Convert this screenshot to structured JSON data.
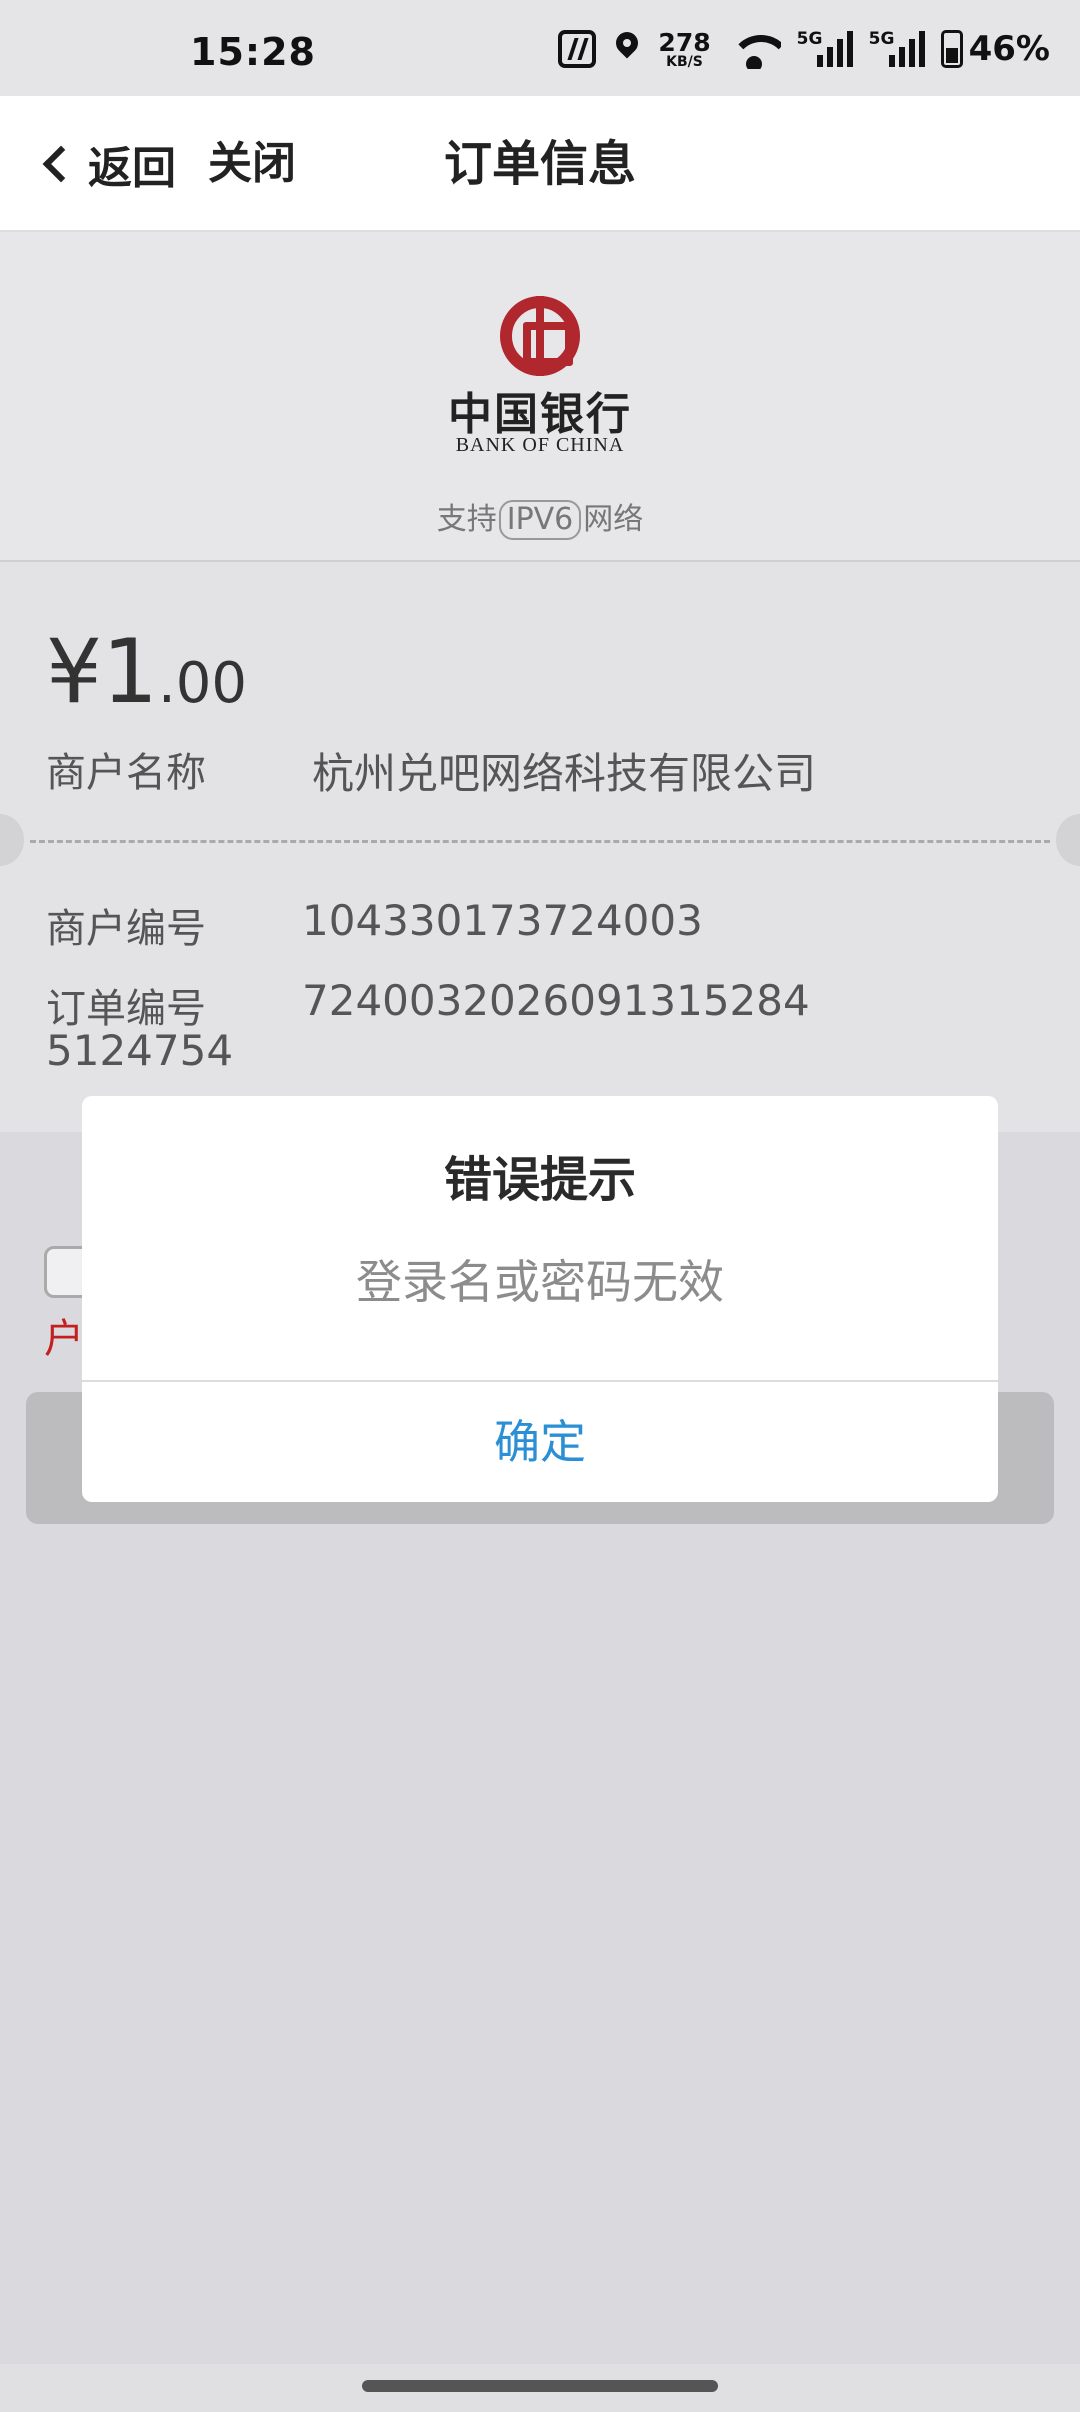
{
  "status_bar": {
    "time": "15:28",
    "speed_value": "278",
    "speed_unit": "KB/S",
    "signal_1": "5G",
    "signal_2": "5G",
    "battery": "46%",
    "icons": [
      "nfc-icon",
      "location-icon",
      "wifi-icon",
      "signal-icon",
      "battery-icon"
    ]
  },
  "nav": {
    "back_label": "返回",
    "close_label": "关闭",
    "title": "订单信息"
  },
  "bank": {
    "name_cn": "中国银行",
    "name_en": "BANK OF CHINA",
    "ipv6_prefix": "支持",
    "ipv6_badge": "IPV6",
    "ipv6_suffix": "网络",
    "logo_color": "#b0272e"
  },
  "order": {
    "currency": "¥",
    "amount_int": "1",
    "amount_dec": ".00",
    "merchant_name_label": "商户名称",
    "merchant_name": "杭州兑吧网络科技有限公司",
    "merchant_no_label": "商户编号",
    "merchant_no": "104330173724003",
    "order_no_label": "订单编号",
    "order_no_line1": "7240032026091315284",
    "order_no_line2": "5124754"
  },
  "behind": {
    "red_text": "户"
  },
  "dialog": {
    "title": "错误提示",
    "message": "登录名或密码无效",
    "confirm_label": "确定",
    "confirm_color": "#2b8fd6"
  }
}
